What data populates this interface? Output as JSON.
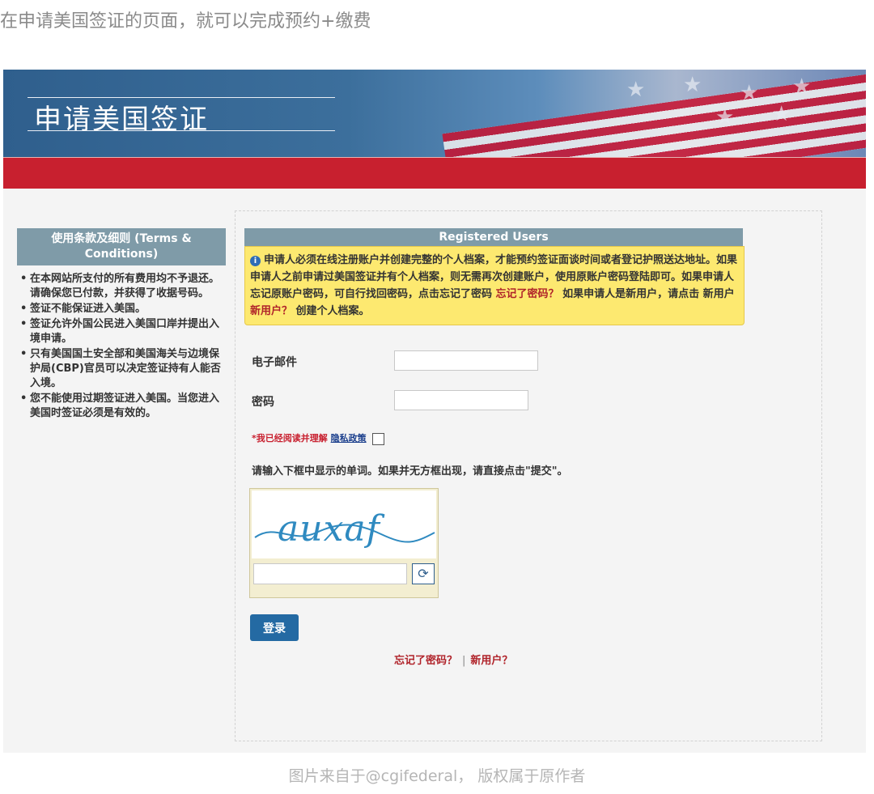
{
  "article": {
    "caption_top": "在申请美国签证的页面，就可以完成预约+缴费",
    "caption_bottom": "图片来自于@cgifederal， 版权属于原作者"
  },
  "banner": {
    "title": "申请美国签证"
  },
  "sidebar": {
    "heading": "使用条款及细则 (Terms & Conditions)",
    "items": [
      "在本网站所支付的所有费用均不予退还。请确保您已付款，并获得了收据号码。",
      "签证不能保证进入美国。",
      "签证允许外国公民进入美国口岸并提出入境申请。",
      "只有美国国土安全部和美国海关与边境保护局(CBP)官员可以决定签证持有人能否入境。",
      "您不能使用过期签证进入美国。当您进入美国时签证必须是有效的。"
    ]
  },
  "login": {
    "section_title": "Registered Users",
    "notice": {
      "text_1": "申请人必须在线注册账户并创建完整的个人档案，才能预约签证面谈时间或者登记护照送达地址。如果申请人之前申请过美国签证并有个人档案，则无需再次创建账户，使用原账户密码登陆即可。如果申请人忘记原账户密码，可自行找回密码，点击忘记了密码",
      "forgot_link": "忘记了密码？",
      "text_2": "如果申请人是新用户，请点击 新用户",
      "new_user_link": "新用户？",
      "text_3": "创建个人档案。"
    },
    "email_label": "电子邮件",
    "password_label": "密码",
    "agree_text": "*我已经阅读并理解",
    "privacy_link": "隐私政策",
    "captcha_hint": "请输入下框中显示的单词。如果并无方框出现，请直接点击\"提交\"。",
    "captcha_word": "auxaf",
    "login_button": "登录",
    "forgot_password": "忘记了密码？",
    "new_user": "新用户？",
    "separator": "|"
  },
  "colors": {
    "banner_blue": "#2f5f8d",
    "red_bar": "#c8202f",
    "header_bar": "#7f9ba8",
    "notice_yellow": "#fde970",
    "button_blue": "#246aa3",
    "link_red": "#b0232a"
  },
  "icons": {
    "info": "info-icon",
    "refresh": "refresh-icon"
  }
}
